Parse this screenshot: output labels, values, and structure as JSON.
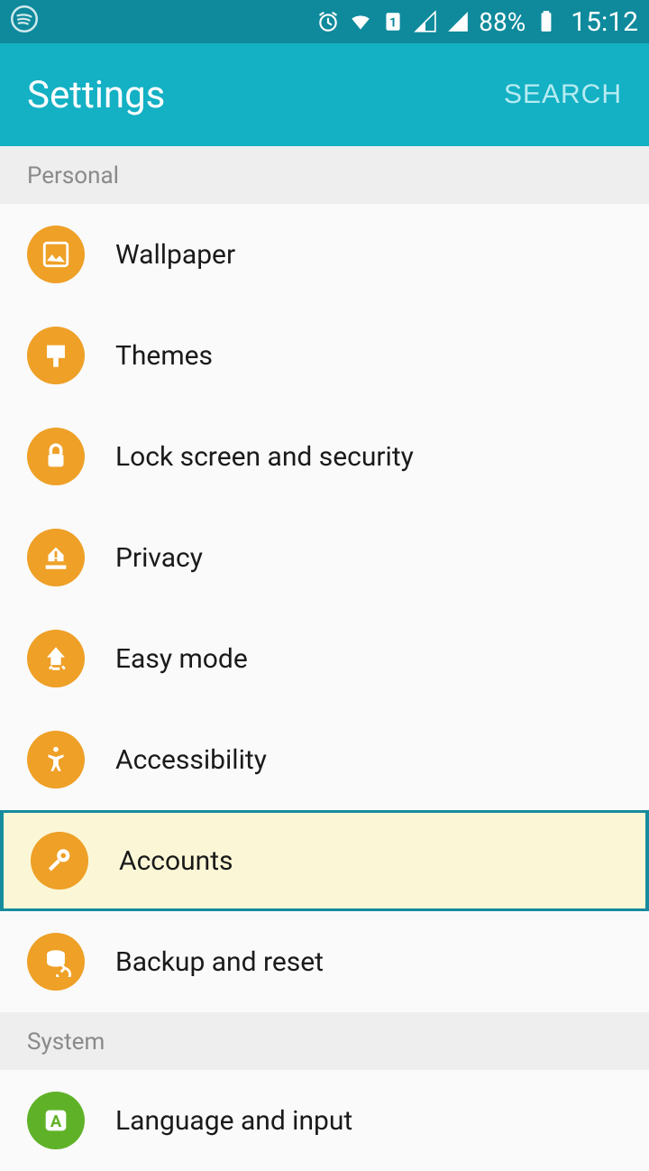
{
  "status_bar": {
    "battery_pct": "88%",
    "time": "15:12"
  },
  "app_bar": {
    "title": "Settings",
    "search_label": "SEARCH"
  },
  "sections": [
    {
      "header": "Personal",
      "items": [
        {
          "label": "Wallpaper",
          "icon": "wallpaper",
          "color": "orange"
        },
        {
          "label": "Themes",
          "icon": "themes",
          "color": "orange"
        },
        {
          "label": "Lock screen and security",
          "icon": "lock",
          "color": "orange"
        },
        {
          "label": "Privacy",
          "icon": "privacy",
          "color": "orange"
        },
        {
          "label": "Easy mode",
          "icon": "easy-mode",
          "color": "orange"
        },
        {
          "label": "Accessibility",
          "icon": "accessibility",
          "color": "orange"
        },
        {
          "label": "Accounts",
          "icon": "accounts",
          "color": "orange",
          "highlighted": true
        },
        {
          "label": "Backup and reset",
          "icon": "backup",
          "color": "orange"
        }
      ]
    },
    {
      "header": "System",
      "items": [
        {
          "label": "Language and input",
          "icon": "language",
          "color": "green"
        }
      ]
    }
  ]
}
